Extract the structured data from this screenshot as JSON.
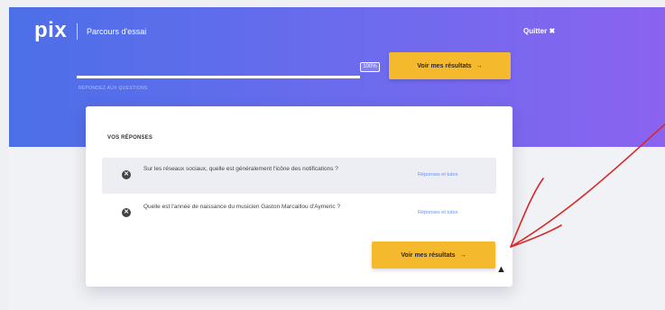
{
  "header": {
    "logo": "pix",
    "course_title": "Parcours d'essai",
    "quit_label": "Quitter ✖"
  },
  "progress": {
    "value": 1.0,
    "badge": "100%",
    "caption": "RÉPONDEZ AUX QUESTIONS"
  },
  "buttons": {
    "see_results_label": "Voir mes résultats",
    "arrow": "→"
  },
  "card": {
    "title": "VOS RÉPONSES",
    "answers": [
      {
        "status_icon": "✕",
        "question": "Sur les réseaux sociaux, quelle est généralement l'icône des notifications ?",
        "link": "Réponses et tutos"
      },
      {
        "status_icon": "✕",
        "question": "Quelle est l'année de naissance du musicien Gaston Marcaillou d'Aymeric ?",
        "link": "Réponses et tutos"
      }
    ]
  },
  "colors": {
    "gradient_start": "#4c6fe8",
    "gradient_end": "#8a63f0",
    "accent_yellow": "#f4b92d",
    "link_blue": "#6a8ee8",
    "annotation_red": "#d62828"
  },
  "icons": {
    "cursor": "cursor-arrow-icon",
    "annotation": "hand-drawn-arrow-icon"
  }
}
